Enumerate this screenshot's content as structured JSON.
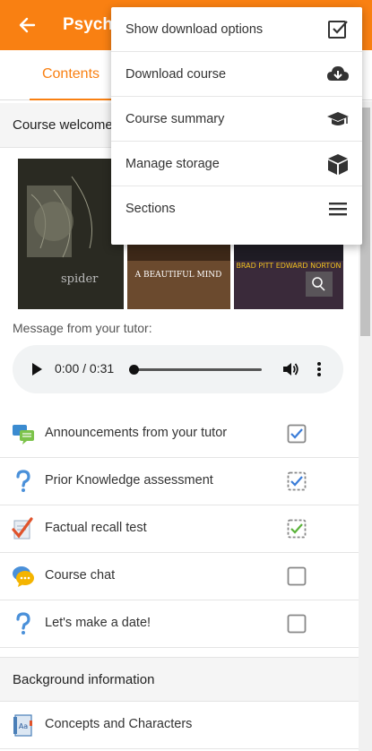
{
  "header": {
    "title": "Psych",
    "back_icon": "arrow-left-icon",
    "color": "#f98012"
  },
  "tabs": [
    {
      "label": "Contents",
      "active": true
    }
  ],
  "menu": {
    "items": [
      {
        "label": "Show download options",
        "icon": "checkbox-checked-icon"
      },
      {
        "label": "Download course",
        "icon": "cloud-download-icon"
      },
      {
        "label": "Course summary",
        "icon": "graduation-cap-icon"
      },
      {
        "label": "Manage storage",
        "icon": "cube-icon"
      },
      {
        "label": "Sections",
        "icon": "hamburger-menu-icon"
      }
    ]
  },
  "sections": [
    {
      "title": "Course welcome",
      "message_label": "Message from your tutor:",
      "audio": {
        "time": "0:00 / 0:31",
        "progress": 0
      },
      "poster_titles": [
        "spider",
        "A BEAUTIFUL MIND",
        "BRAD PITT EDWARD NORTON"
      ],
      "activities": [
        {
          "label": "Announcements from your tutor",
          "icon": "forum-icon",
          "completion": "manual-checked"
        },
        {
          "label": "Prior Knowledge assessment",
          "icon": "question-icon",
          "completion": "auto-checked"
        },
        {
          "label": "Factual recall test",
          "icon": "quiz-icon",
          "completion": "auto-passed"
        },
        {
          "label": "Course chat",
          "icon": "chat-icon",
          "completion": "manual-unchecked"
        },
        {
          "label": "Let's make a date!",
          "icon": "question-icon",
          "completion": "manual-unchecked"
        }
      ]
    },
    {
      "title": "Background information",
      "activities": [
        {
          "label": "Concepts and Characters",
          "icon": "glossary-icon"
        }
      ]
    }
  ]
}
